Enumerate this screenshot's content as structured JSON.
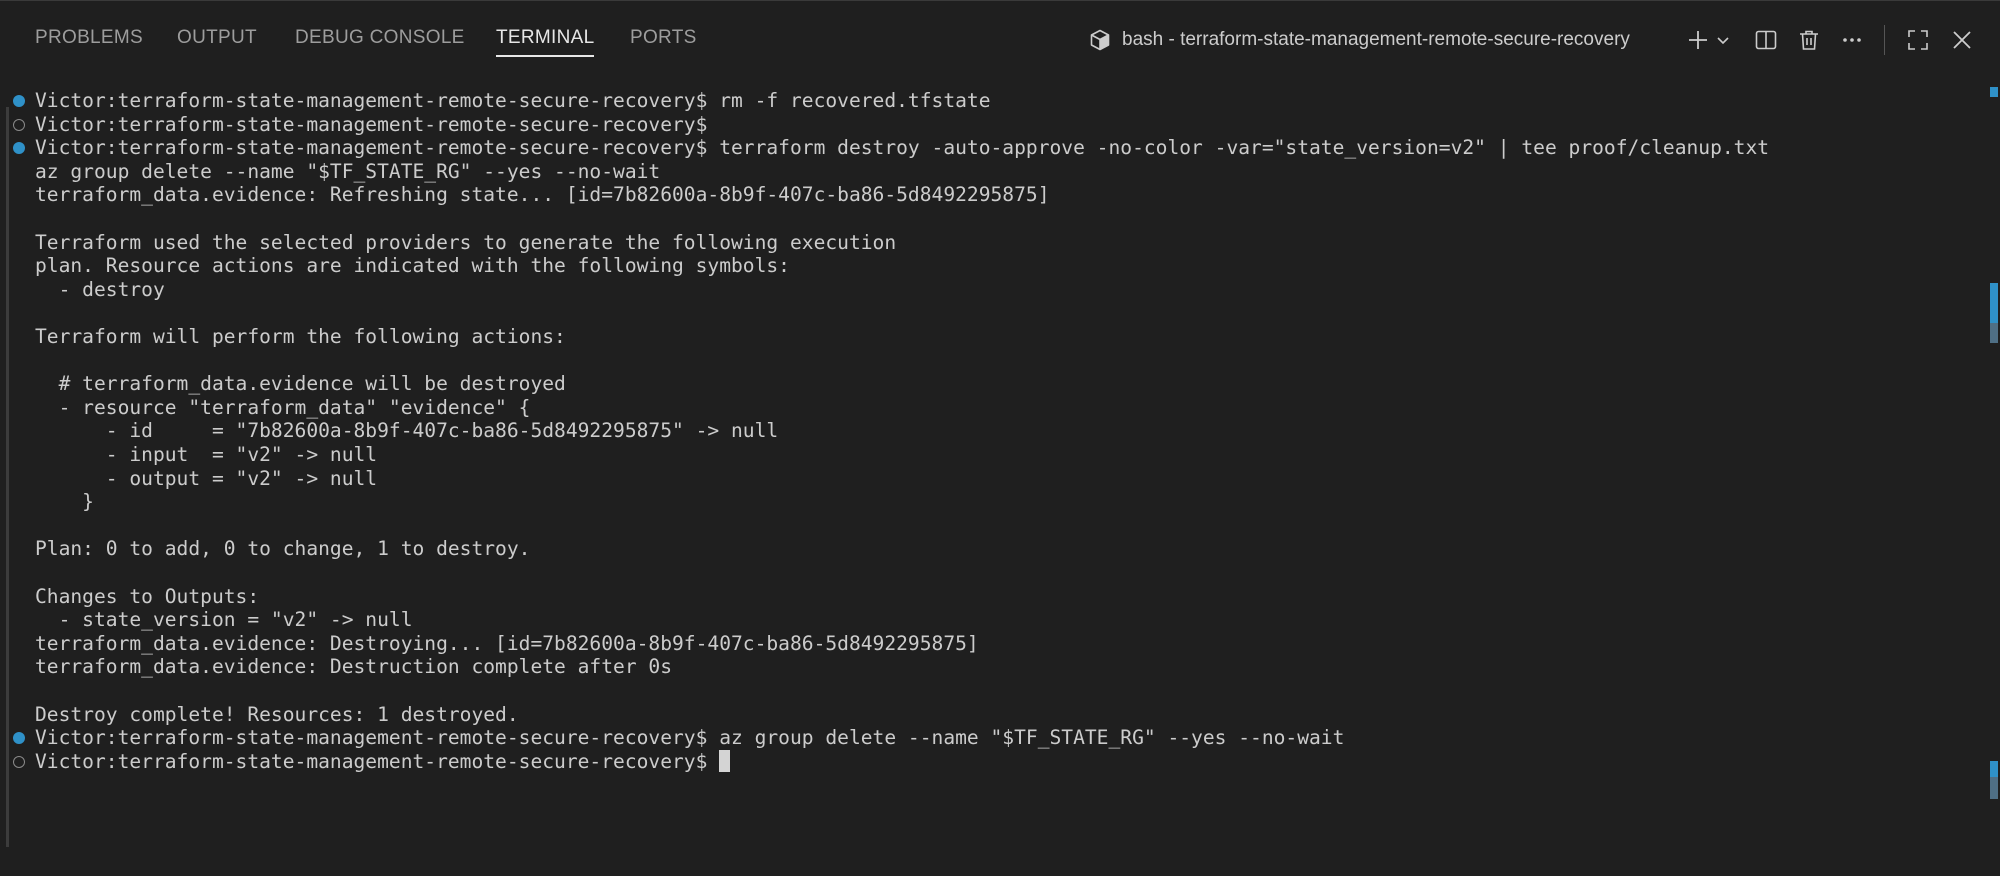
{
  "tabs": [
    {
      "label": "PROBLEMS",
      "active": false
    },
    {
      "label": "OUTPUT",
      "active": false
    },
    {
      "label": "DEBUG CONSOLE",
      "active": false
    },
    {
      "label": "TERMINAL",
      "active": true
    },
    {
      "label": "PORTS",
      "active": false
    }
  ],
  "terminal_title": "bash - terraform-state-management-remote-secure-recovery",
  "icons": {
    "shell": "cube-icon",
    "new_terminal": "plus-icon",
    "launch_profile": "chevron-down-icon",
    "split": "split-terminal-icon",
    "kill": "trash-icon",
    "more": "ellipsis-icon",
    "maximize": "maximize-icon",
    "close": "close-icon"
  },
  "colors": {
    "background": "#1f1f1f",
    "text": "#cccccc",
    "active_tab": "#e7e7e7",
    "inactive_tab": "#9d9d9d",
    "decoration_success": "#2f91c8",
    "decoration_pending": "#8a8a8a",
    "scrollbar_marker": "#2f91c8"
  },
  "terminal": {
    "lines": [
      {
        "text": "Victor:terraform-state-management-remote-secure-recovery$ rm -f recovered.tfstate",
        "decoration": "filled"
      },
      {
        "text": "Victor:terraform-state-management-remote-secure-recovery$",
        "decoration": "hollow"
      },
      {
        "text": "Victor:terraform-state-management-remote-secure-recovery$ terraform destroy -auto-approve -no-color -var=\"state_version=v2\" | tee proof/cleanup.txt",
        "decoration": "filled"
      },
      {
        "text": "az group delete --name \"$TF_STATE_RG\" --yes --no-wait"
      },
      {
        "text": "terraform_data.evidence: Refreshing state... [id=7b82600a-8b9f-407c-ba86-5d8492295875]"
      },
      {
        "text": ""
      },
      {
        "text": "Terraform used the selected providers to generate the following execution"
      },
      {
        "text": "plan. Resource actions are indicated with the following symbols:"
      },
      {
        "text": "  - destroy"
      },
      {
        "text": ""
      },
      {
        "text": "Terraform will perform the following actions:"
      },
      {
        "text": ""
      },
      {
        "text": "  # terraform_data.evidence will be destroyed"
      },
      {
        "text": "  - resource \"terraform_data\" \"evidence\" {"
      },
      {
        "text": "      - id     = \"7b82600a-8b9f-407c-ba86-5d8492295875\" -> null"
      },
      {
        "text": "      - input  = \"v2\" -> null"
      },
      {
        "text": "      - output = \"v2\" -> null"
      },
      {
        "text": "    }"
      },
      {
        "text": ""
      },
      {
        "text": "Plan: 0 to add, 0 to change, 1 to destroy."
      },
      {
        "text": ""
      },
      {
        "text": "Changes to Outputs:"
      },
      {
        "text": "  - state_version = \"v2\" -> null"
      },
      {
        "text": "terraform_data.evidence: Destroying... [id=7b82600a-8b9f-407c-ba86-5d8492295875]"
      },
      {
        "text": "terraform_data.evidence: Destruction complete after 0s"
      },
      {
        "text": ""
      },
      {
        "text": "Destroy complete! Resources: 1 destroyed."
      },
      {
        "text": "Victor:terraform-state-management-remote-secure-recovery$ az group delete --name \"$TF_STATE_RG\" --yes --no-wait",
        "decoration": "filled"
      },
      {
        "text": "Victor:terraform-state-management-remote-secure-recovery$ ",
        "decoration": "hollow",
        "cursor": true
      }
    ]
  }
}
